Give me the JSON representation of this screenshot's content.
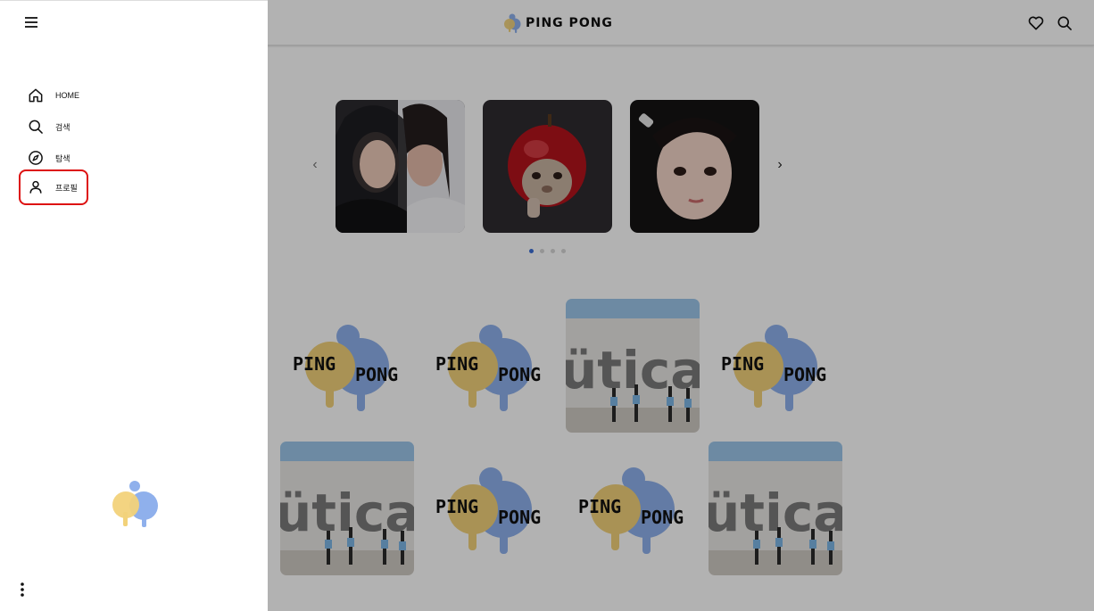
{
  "header": {
    "brand_text": "PING PONG",
    "icons": [
      "heart-icon",
      "search-icon"
    ]
  },
  "carousel": {
    "prev_symbol": "‹",
    "next_symbol": "›",
    "slides": [
      "photo",
      "photo",
      "photo"
    ],
    "page_count": 4,
    "active_page": 1
  },
  "grid": {
    "tiles": [
      "logo",
      "logo",
      "photo",
      "logo",
      "photo",
      "logo",
      "logo",
      "photo"
    ],
    "logo_text_top": "PING",
    "logo_text_bottom": "PONG"
  },
  "drawer": {
    "nav": [
      {
        "label": "HOME",
        "icon": "home-icon"
      },
      {
        "label": "검색",
        "icon": "search-icon"
      },
      {
        "label": "탐색",
        "icon": "compass-icon"
      },
      {
        "label": "프로필",
        "icon": "user-icon",
        "selected": true
      }
    ],
    "footer_icon": "more-vertical-icon"
  },
  "colors": {
    "logo_yellow": "#f2d27a",
    "logo_blue": "#8fb0ec",
    "highlight_border": "#dd1111",
    "active_dot": "#3b6fd6"
  }
}
